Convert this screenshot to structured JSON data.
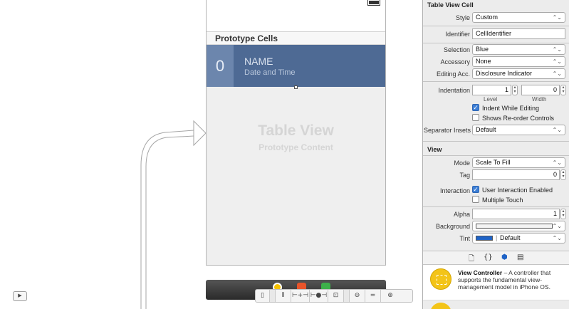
{
  "canvas": {
    "section_header": "Prototype Cells",
    "cell": {
      "badge": "0",
      "name": "NAME",
      "detail": "Date and Time"
    },
    "placeholder_title": "Table View",
    "placeholder_subtitle": "Prototype Content",
    "bottom_bar": {
      "buttons": [
        "▯",
        "⫴",
        "⊢+⊣",
        "⊢●⊣",
        "⊡",
        "⊖",
        "=",
        "⊕"
      ]
    },
    "outline_toggle": "▶"
  },
  "inspector": {
    "cell_section": {
      "title": "Table View Cell",
      "style_label": "Style",
      "style_value": "Custom",
      "identifier_label": "Identifier",
      "identifier_value": "CellIdentifier",
      "selection_label": "Selection",
      "selection_value": "Blue",
      "accessory_label": "Accessory",
      "accessory_value": "None",
      "editing_label": "Editing Acc.",
      "editing_value": "Disclosure Indicator",
      "indentation_label": "Indentation",
      "level_value": "1",
      "level_caption": "Level",
      "width_value": "0",
      "width_caption": "Width",
      "indent_while_editing": "Indent While Editing",
      "indent_while_editing_checked": true,
      "shows_reorder": "Shows Re-order Controls",
      "shows_reorder_checked": false,
      "separator_label": "Separator Insets",
      "separator_value": "Default"
    },
    "view_section": {
      "title": "View",
      "mode_label": "Mode",
      "mode_value": "Scale To Fill",
      "tag_label": "Tag",
      "tag_value": "0",
      "interaction_label": "Interaction",
      "user_interaction": "User Interaction Enabled",
      "user_interaction_checked": true,
      "multiple_touch": "Multiple Touch",
      "multiple_touch_checked": false,
      "alpha_label": "Alpha",
      "alpha_value": "1",
      "background_label": "Background",
      "tint_label": "Tint",
      "tint_value": "Default",
      "tint_color": "#1f63c6"
    },
    "library": {
      "tabs": [
        "🗋",
        "{}",
        "⬢",
        "▤"
      ],
      "item_title": "View Controller",
      "item_desc": " – A controller that supports the fundamental view-management model in iPhone OS."
    }
  },
  "colors": {
    "cell_bg": "#4e6a94",
    "badge_bg": "#6c86ad",
    "checkbox_blue": "#3d7fd6"
  }
}
